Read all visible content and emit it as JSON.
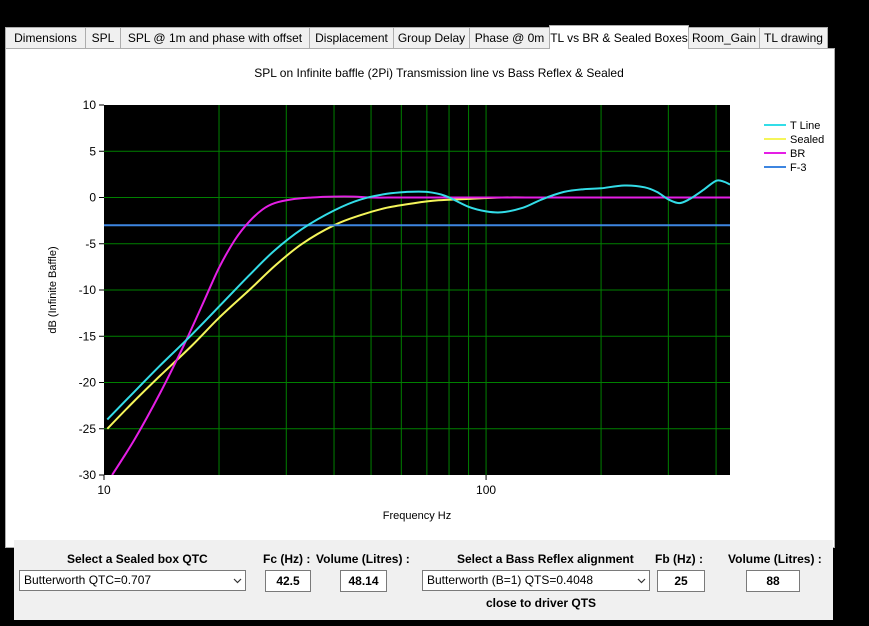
{
  "tabs": [
    {
      "label": "Dimensions",
      "active": false
    },
    {
      "label": "SPL",
      "active": false
    },
    {
      "label": "SPL @ 1m and phase with offset",
      "active": false
    },
    {
      "label": "Displacement",
      "active": false
    },
    {
      "label": "Group Delay",
      "active": false
    },
    {
      "label": "Phase @ 0m",
      "active": false
    },
    {
      "label": "TL vs BR & Sealed Boxes",
      "active": true
    },
    {
      "label": "Room_Gain",
      "active": false
    },
    {
      "label": "TL drawing",
      "active": false
    }
  ],
  "chart_data": {
    "type": "line",
    "title": "SPL on Infinite baffle (2Pi) Transmission line vs Bass Reflex & Sealed",
    "xlabel": "Frequency Hz",
    "ylabel": "dB (Infinite Baffle)",
    "xscale": "log",
    "xlim": [
      10,
      435
    ],
    "ylim": [
      -30,
      10
    ],
    "xticks": [
      {
        "value": 10,
        "label": "10"
      },
      {
        "value": 100,
        "label": "100"
      }
    ],
    "yticks": [
      10,
      5,
      0,
      -5,
      -10,
      -15,
      -20,
      -25,
      -30
    ],
    "grid": true,
    "background": "#000000",
    "grid_color": "#008000",
    "legend_position": "top-right",
    "series": [
      {
        "name": "T Line",
        "color": "#33dde8",
        "x": [
          10.2,
          12,
          14,
          17,
          20,
          24,
          28,
          33,
          40,
          47,
          55,
          62,
          70,
          78,
          90,
          100,
          110,
          125,
          140,
          160,
          180,
          200,
          230,
          260,
          280,
          300,
          320,
          340,
          370,
          400,
          420,
          435
        ],
        "y": [
          -24,
          -21,
          -18.2,
          -14.8,
          -11.8,
          -8.4,
          -5.7,
          -3.4,
          -1.4,
          -0.2,
          0.4,
          0.6,
          0.6,
          0.2,
          -1.0,
          -1.5,
          -1.6,
          -1.1,
          -0.2,
          0.6,
          0.9,
          1.0,
          1.3,
          1.1,
          0.6,
          -0.2,
          -0.6,
          -0.2,
          0.8,
          1.8,
          1.7,
          1.4
        ]
      },
      {
        "name": "Sealed",
        "color": "#f5f55a",
        "x": [
          10.2,
          12,
          14,
          17,
          20,
          24,
          28,
          33,
          40,
          47,
          55,
          65,
          75,
          90,
          110,
          140,
          200,
          300,
          435
        ],
        "y": [
          -25,
          -22,
          -19.3,
          -16,
          -13,
          -10,
          -7.4,
          -5,
          -3.0,
          -1.9,
          -1.1,
          -0.6,
          -0.3,
          -0.15,
          0,
          0,
          0,
          0,
          0
        ]
      },
      {
        "name": "BR",
        "color": "#e51ee5",
        "x": [
          10.5,
          12,
          14,
          16,
          18,
          20,
          22,
          24,
          26,
          28,
          31,
          35,
          40,
          45,
          50,
          60,
          80,
          120,
          200,
          435
        ],
        "y": [
          -30,
          -26.2,
          -21.2,
          -16.4,
          -11.8,
          -7.6,
          -4.6,
          -2.6,
          -1.3,
          -0.6,
          -0.2,
          0,
          0.1,
          0.1,
          0,
          0,
          0,
          0,
          0,
          0
        ]
      },
      {
        "name": "F-3",
        "color": "#3d85e0",
        "x": [
          10,
          435
        ],
        "y": [
          -3,
          -3
        ]
      }
    ]
  },
  "controls": {
    "sealed_label": "Select a Sealed box QTC",
    "sealed_value": "Butterworth QTC=0.707",
    "fc_label": "Fc (Hz) :",
    "fc_value": "42.5",
    "sealed_volume_label": "Volume (Litres) :",
    "sealed_volume_value": "48.14",
    "br_label": "Select a Bass Reflex alignment",
    "br_value": "Butterworth (B=1) QTS=0.4048",
    "br_note": "close to driver QTS",
    "fb_label": "Fb (Hz) :",
    "fb_value": "25",
    "br_volume_label": "Volume (Litres) :",
    "br_volume_value": "88"
  }
}
